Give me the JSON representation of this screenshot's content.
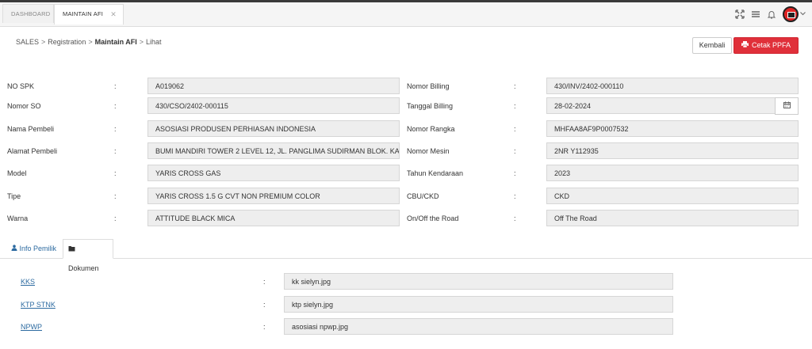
{
  "tabs": {
    "dashboard": "DASHBOARD",
    "active": "MAINTAIN AFI",
    "close": "✕"
  },
  "breadcrumb": {
    "sales": "SALES",
    "registration": "Registration",
    "maintain": "Maintain AFI",
    "lihat": "Lihat",
    "sep": ">"
  },
  "buttons": {
    "kembali": "Kembali",
    "cetak": "Cetak PPFA"
  },
  "colon": ":",
  "left_fields": [
    {
      "label": "NO SPK",
      "value": "A019062"
    },
    {
      "label": "Nomor SO",
      "value": "430/CSO/2402-000115"
    },
    {
      "label": "Nama Pembeli",
      "value": "ASOSIASI PRODUSEN PERHIASAN INDONESIA"
    },
    {
      "label": "Alamat Pembeli",
      "value": "BUMI MANDIRI TOWER 2 LEVEL 12, JL. PANGLIMA SUDIRMAN BLOK. KA"
    },
    {
      "label": "Model",
      "value": "YARIS CROSS GAS"
    },
    {
      "label": "Tipe",
      "value": "YARIS CROSS 1.5 G CVT NON PREMIUM COLOR"
    },
    {
      "label": "Warna",
      "value": "ATTITUDE BLACK MICA"
    }
  ],
  "right_fields": [
    {
      "label": "Nomor Billing",
      "value": "430/INV/2402-000110"
    },
    {
      "label": "Tanggal Billing",
      "value": "28-02-2024"
    },
    {
      "label": "Nomor Rangka",
      "value": "MHFAA8AF9P0007532"
    },
    {
      "label": "Nomor Mesin",
      "value": "2NR Y112935"
    },
    {
      "label": "Tahun Kendaraan",
      "value": "2023"
    },
    {
      "label": "CBU/CKD",
      "value": "CKD"
    },
    {
      "label": "On/Off the Road",
      "value": "Off The Road"
    }
  ],
  "subtabs": {
    "info": "Info Pemilik",
    "dokumen": "Dokumen"
  },
  "documents": [
    {
      "label": "KKS",
      "value": "kk sielyn.jpg"
    },
    {
      "label": "KTP STNK",
      "value": "ktp sielyn.jpg"
    },
    {
      "label": "NPWP",
      "value": "asosiasi npwp.jpg"
    }
  ],
  "icons": {
    "expand": "expand-icon",
    "menu": "menu-icon",
    "bell": "bell-icon",
    "calendar": "calendar-icon",
    "print": "print-icon",
    "user": "user-icon",
    "folder": "folder-icon"
  },
  "colors": {
    "accent_red": "#e0303a",
    "link_blue": "#2c6aa0",
    "field_bg": "#eeeeee"
  }
}
